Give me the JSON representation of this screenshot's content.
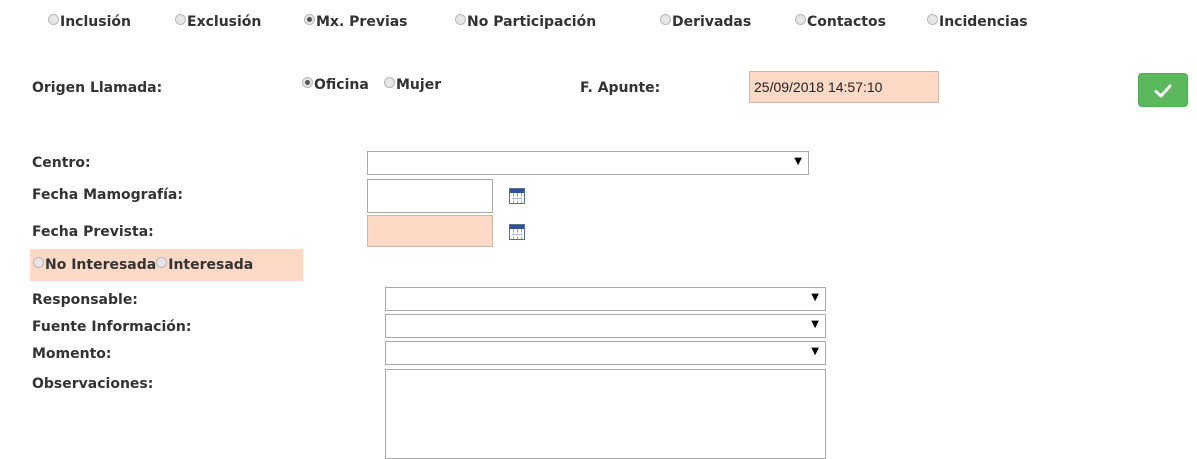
{
  "tabs": [
    {
      "label": "Inclusión",
      "checked": false
    },
    {
      "label": "Exclusión",
      "checked": false
    },
    {
      "label": "Mx. Previas",
      "checked": true
    },
    {
      "label": "No Participación",
      "checked": false
    },
    {
      "label": "Derivadas",
      "checked": false
    },
    {
      "label": "Contactos",
      "checked": false
    },
    {
      "label": "Incidencias",
      "checked": false
    }
  ],
  "origen": {
    "label": "Origen Llamada:",
    "options": [
      {
        "label": "Oficina",
        "checked": true
      },
      {
        "label": "Mujer",
        "checked": false
      }
    ]
  },
  "apunte": {
    "label": "F. Apunte:",
    "value": "25/09/2018 14:57:10"
  },
  "save_icon": "check-icon",
  "form": {
    "centro_label": "Centro:",
    "fecha_mamografia_label": "Fecha Mamografía:",
    "fecha_prevista_label": "Fecha Prevista:",
    "interes_options": [
      {
        "label": "No Interesada",
        "checked": false
      },
      {
        "label": "Interesada",
        "checked": false
      }
    ],
    "responsable_label": "Responsable:",
    "fuente_label": "Fuente Información:",
    "momento_label": "Momento:",
    "observaciones_label": "Observaciones:",
    "dropdown_arrow": "▼"
  },
  "colors": {
    "required_bg": "#fdd9c6",
    "save_button": "#5cb85c"
  }
}
